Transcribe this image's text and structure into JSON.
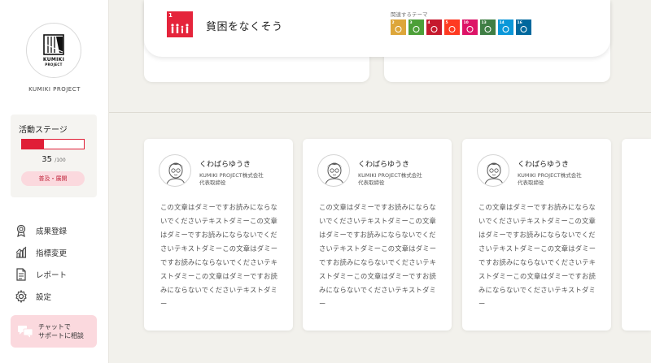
{
  "sidebar": {
    "logo": {
      "line1": "KUMIKI",
      "line2": "PROJECT"
    },
    "project_name": "KUMIKI PROJECT",
    "stage": {
      "title": "活動ステージ",
      "value": "35",
      "max": "/100",
      "progress": 0.35,
      "progress_color": "#e01e37",
      "button_label": "普及・展開"
    },
    "nav": [
      {
        "label": "成果登録",
        "icon": "medal-icon"
      },
      {
        "label": "指標変更",
        "icon": "chart-icon"
      },
      {
        "label": "レポート",
        "icon": "document-icon"
      },
      {
        "label": "設定",
        "icon": "gear-icon"
      }
    ],
    "chat": {
      "line1": "チャットで",
      "line2": "サポートに相談",
      "icon": "chat-bubbles-icon"
    }
  },
  "goal": {
    "number": "1",
    "title": "貧困をなくそう",
    "color": "#e5243b",
    "related_label": "関連するテーマ",
    "related": [
      {
        "number": "2",
        "color": "#dda63a"
      },
      {
        "number": "3",
        "color": "#4c9f38"
      },
      {
        "number": "4",
        "color": "#c5192d"
      },
      {
        "number": "5",
        "color": "#ff3a21"
      },
      {
        "number": "10",
        "color": "#dd1367"
      },
      {
        "number": "13",
        "color": "#3f7e44"
      },
      {
        "number": "14",
        "color": "#0a97d9"
      },
      {
        "number": "16",
        "color": "#00689d"
      }
    ]
  },
  "members": [
    {
      "name": "くわばらゆうき",
      "company": "KUMIKI PROJECT株式会社",
      "role": "代表取締役",
      "body": "この文章はダミーですお読みにならないでくださいテキストダミーこの文章はダミーですお読みにならないでくださいテキストダミーこの文章はダミーですお読みにならないでくださいテキストダミーこの文章はダミーですお読みにならないでくださいテキストダミー"
    },
    {
      "name": "くわばらゆうき",
      "company": "KUMIKI PROJECT株式会社",
      "role": "代表取締役",
      "body": "この文章はダミーですお読みにならないでくださいテキストダミーこの文章はダミーですお読みにならないでくださいテキストダミーこの文章はダミーですお読みにならないでくださいテキストダミーこの文章はダミーですお読みにならないでくださいテキストダミー"
    },
    {
      "name": "くわばらゆうき",
      "company": "KUMIKI PROJECT株式会社",
      "role": "代表取締役",
      "body": "この文章はダミーですお読みにならないでくださいテキストダミーこの文章はダミーですお読みにならないでくださいテキストダミーこの文章はダミーですお読みにならないでくださいテキストダミーこの文章はダミーですお読みにならないでくださいテキストダミー"
    }
  ]
}
